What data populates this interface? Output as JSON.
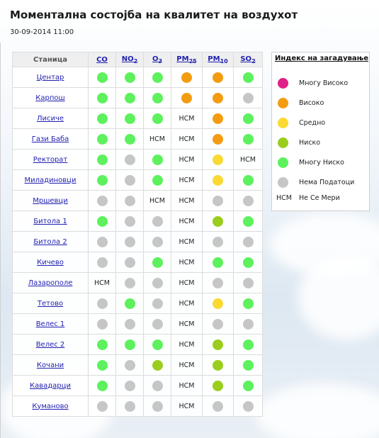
{
  "page": {
    "title": "Моментална состојба на квалитет на воздухот",
    "timestamp": "30-09-2014 11:00"
  },
  "table": {
    "station_header": "Станица",
    "pollutants": [
      {
        "base": "CO",
        "sub": ""
      },
      {
        "base": "NO",
        "sub": "2"
      },
      {
        "base": "O",
        "sub": "3"
      },
      {
        "base": "PM",
        "sub": "25"
      },
      {
        "base": "PM",
        "sub": "10"
      },
      {
        "base": "SO",
        "sub": "2"
      }
    ],
    "rows": [
      {
        "station": "Центар",
        "values": [
          "verylow",
          "verylow",
          "verylow",
          "high",
          "high",
          "verylow"
        ]
      },
      {
        "station": "Карпош",
        "values": [
          "verylow",
          "verylow",
          "verylow",
          "high",
          "high",
          "nodata"
        ]
      },
      {
        "station": "Лисиче",
        "values": [
          "verylow",
          "verylow",
          "verylow",
          "НСМ",
          "high",
          "verylow"
        ]
      },
      {
        "station": "Гази Баба",
        "values": [
          "verylow",
          "verylow",
          "НСМ",
          "НСМ",
          "high",
          "verylow"
        ]
      },
      {
        "station": "Ректорат",
        "values": [
          "verylow",
          "nodata",
          "verylow",
          "НСМ",
          "medium",
          "НСМ"
        ]
      },
      {
        "station": "Миладиновци",
        "values": [
          "verylow",
          "nodata",
          "verylow",
          "НСМ",
          "medium",
          "verylow"
        ]
      },
      {
        "station": "Мршевци",
        "values": [
          "nodata",
          "nodata",
          "НСМ",
          "НСМ",
          "nodata",
          "nodata"
        ]
      },
      {
        "station": "Битола 1",
        "values": [
          "verylow",
          "nodata",
          "nodata",
          "НСМ",
          "low",
          "verylow"
        ]
      },
      {
        "station": "Битола 2",
        "values": [
          "nodata",
          "nodata",
          "nodata",
          "НСМ",
          "nodata",
          "nodata"
        ]
      },
      {
        "station": "Кичево",
        "values": [
          "nodata",
          "nodata",
          "verylow",
          "НСМ",
          "verylow",
          "verylow"
        ]
      },
      {
        "station": "Лазарополе",
        "values": [
          "НСМ",
          "nodata",
          "nodata",
          "НСМ",
          "nodata",
          "nodata"
        ]
      },
      {
        "station": "Тетово",
        "values": [
          "nodata",
          "verylow",
          "nodata",
          "НСМ",
          "medium",
          "verylow"
        ]
      },
      {
        "station": "Велес 1",
        "values": [
          "nodata",
          "nodata",
          "nodata",
          "НСМ",
          "nodata",
          "nodata"
        ]
      },
      {
        "station": "Велес 2",
        "values": [
          "verylow",
          "verylow",
          "verylow",
          "НСМ",
          "low",
          "verylow"
        ]
      },
      {
        "station": "Кочани",
        "values": [
          "verylow",
          "nodata",
          "low",
          "НСМ",
          "low",
          "verylow"
        ]
      },
      {
        "station": "Кавадарци",
        "values": [
          "verylow",
          "nodata",
          "nodata",
          "НСМ",
          "low",
          "verylow"
        ]
      },
      {
        "station": "Куманово",
        "values": [
          "nodata",
          "nodata",
          "nodata",
          "НСМ",
          "nodata",
          "nodata"
        ]
      }
    ]
  },
  "colors": {
    "veryhigh": "#e0218a",
    "high": "#f39c12",
    "medium": "#fad933",
    "low": "#9acd1e",
    "verylow": "#5df15d",
    "nodata": "#c6c6c6"
  },
  "legend": {
    "title": "Индекс на загадување",
    "items": [
      {
        "key": "veryhigh",
        "label": "Многу Високо"
      },
      {
        "key": "high",
        "label": "Високо"
      },
      {
        "key": "medium",
        "label": "Средно"
      },
      {
        "key": "low",
        "label": "Ниско"
      },
      {
        "key": "verylow",
        "label": "Многу Ниско"
      },
      {
        "key": "nodata",
        "label": "Нема Податоци"
      }
    ],
    "nsm_code": "НСМ",
    "nsm_label": "Не Се Мери"
  }
}
